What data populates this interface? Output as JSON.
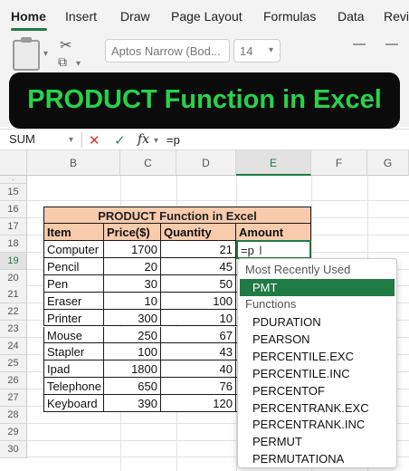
{
  "ribbon": {
    "tabs": [
      "Home",
      "Insert",
      "Draw",
      "Page Layout",
      "Formulas",
      "Data",
      "Revi"
    ],
    "font_name": "Aptos Narrow (Bod...",
    "font_size": "14"
  },
  "banner": {
    "title": "PRODUCT Function in Excel"
  },
  "formula_bar": {
    "name_box": "SUM",
    "cancel": "✕",
    "enter": "✓",
    "fx": "fx",
    "content": "=p"
  },
  "grid": {
    "columns": [
      "B",
      "C",
      "D",
      "E",
      "F",
      "G"
    ],
    "selected_column": "E",
    "rows": [
      "15",
      "16",
      "17",
      "18",
      "19",
      "20",
      "21",
      "22",
      "23",
      "24",
      "25",
      "26",
      "27",
      "28",
      "29",
      "30"
    ],
    "selected_row": "19"
  },
  "table": {
    "title": "PRODUCT Function in Excel",
    "headers": [
      "Item",
      "Price($)",
      "Quantity",
      "Amount"
    ],
    "rows": [
      {
        "item": "Computer",
        "price": "1700",
        "qty": "21"
      },
      {
        "item": "Pencil",
        "price": "20",
        "qty": "45"
      },
      {
        "item": "Pen",
        "price": "30",
        "qty": "50"
      },
      {
        "item": "Eraser",
        "price": "10",
        "qty": "100"
      },
      {
        "item": "Printer",
        "price": "300",
        "qty": "10"
      },
      {
        "item": "Mouse",
        "price": "250",
        "qty": "67"
      },
      {
        "item": "Stapler",
        "price": "100",
        "qty": "43"
      },
      {
        "item": "Ipad",
        "price": "1800",
        "qty": "40"
      },
      {
        "item": "Telephone",
        "price": "650",
        "qty": "76"
      },
      {
        "item": "Keyboard",
        "price": "390",
        "qty": "120"
      }
    ],
    "active_cell_value": "=p"
  },
  "autocomplete": {
    "recent_label": "Most Recently Used",
    "recent": [
      "PMT"
    ],
    "functions_label": "Functions",
    "functions": [
      "PDURATION",
      "PEARSON",
      "PERCENTILE.EXC",
      "PERCENTILE.INC",
      "PERCENTOF",
      "PERCENTRANK.EXC",
      "PERCENTRANK.INC",
      "PERMUT",
      "PERMUTATIONA"
    ]
  },
  "colors": {
    "accent": "#1f7a44",
    "banner_text": "#27d24a",
    "header_fill": "#f8cbad"
  }
}
